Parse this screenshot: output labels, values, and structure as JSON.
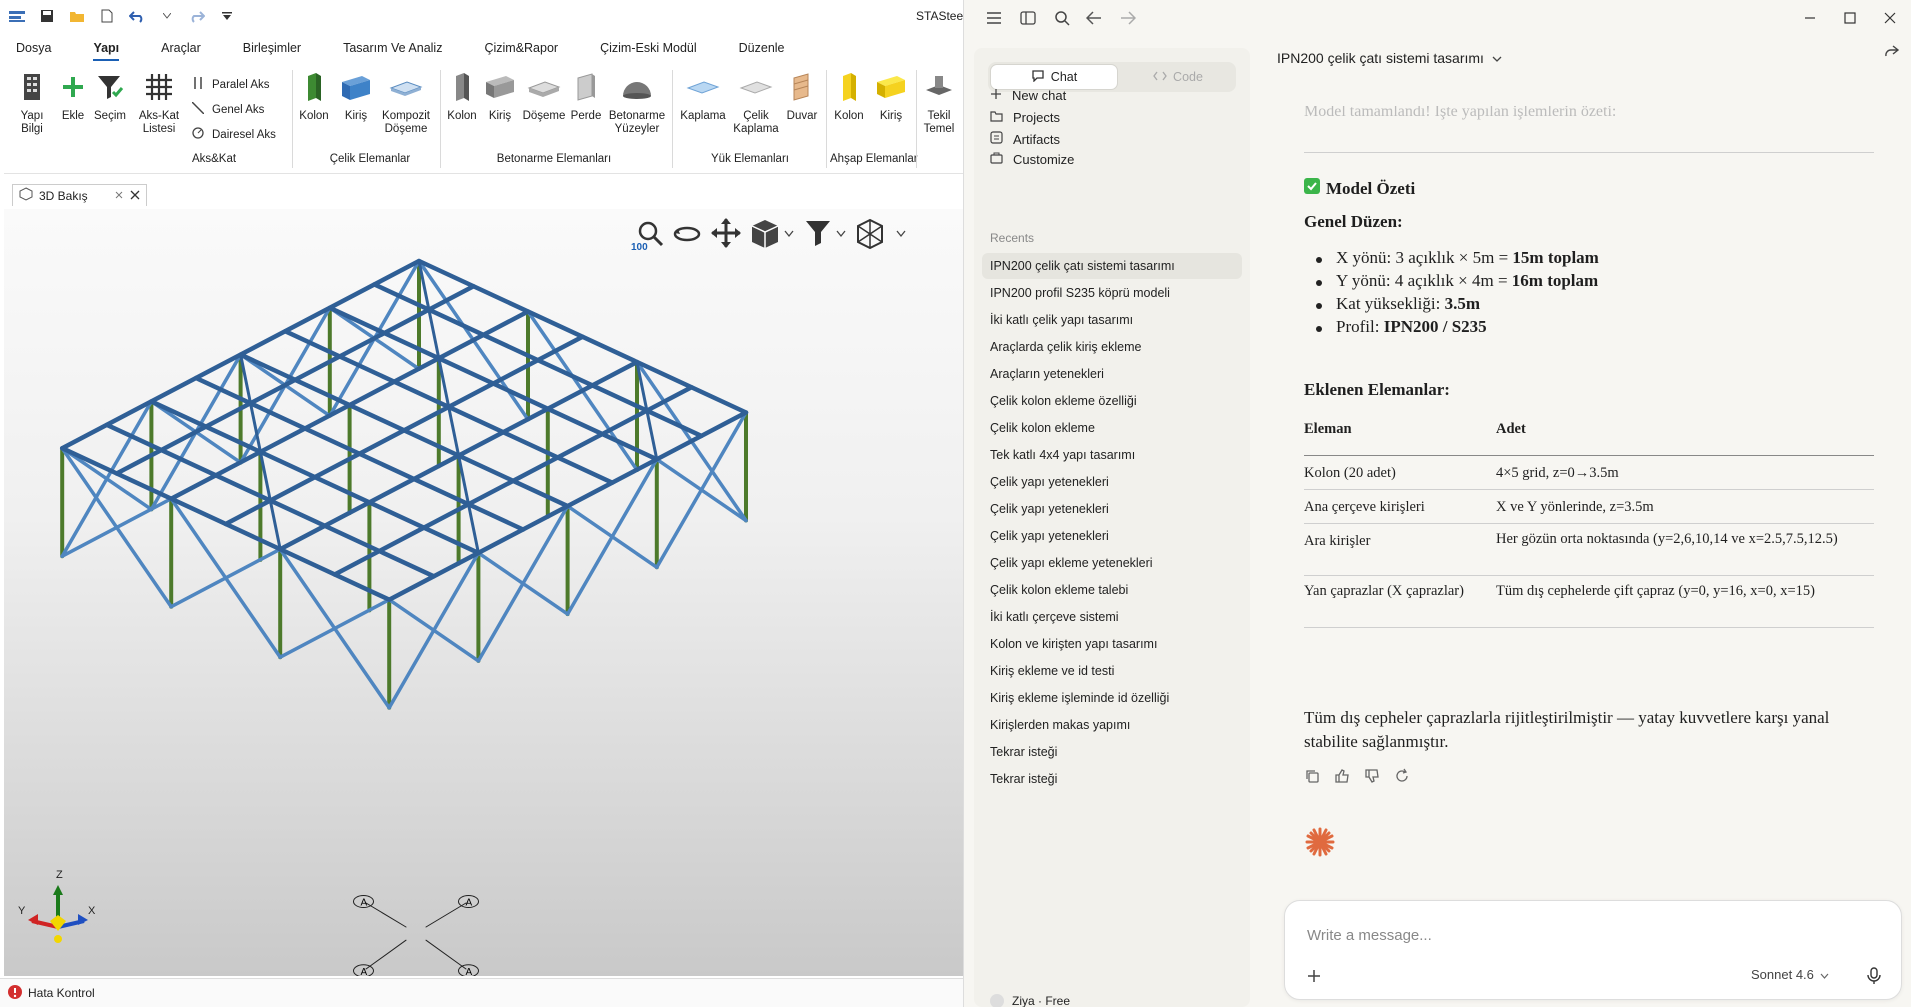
{
  "app": {
    "title": "STASteel",
    "menu": [
      "Dosya",
      "Yapı",
      "Araçlar",
      "Birleşimler",
      "Tasarım Ve Analiz",
      "Çizim&Rapor",
      "Çizim-Eski Modül",
      "Düzenle"
    ],
    "ribbon": {
      "yapi_bilgi": "Yapı Bilgi",
      "ekle": "Ekle",
      "secim": "Seçim",
      "aks_kat_1": "Aks-Kat",
      "aks_kat_2": "Listesi",
      "paralel_aks": "Paralel Aks",
      "genel_aks": "Genel Aks",
      "dairesel_aks": "Dairesel Aks",
      "group_akskat": "Aks&Kat",
      "celik_kolon": "Kolon",
      "celik_kiris": "Kiriş",
      "kompozit_1": "Kompozit",
      "kompozit_2": "Döşeme",
      "group_celik": "Çelik Elemanlar",
      "bet_kolon": "Kolon",
      "bet_kiris": "Kiriş",
      "bet_doseme": "Döşeme",
      "bet_perde": "Perde",
      "bet_yuzey_1": "Betonarme",
      "bet_yuzey_2": "Yüzeyler",
      "group_beton": "Betonarme Elemanları",
      "kaplama": "Kaplama",
      "celik_kaplama_1": "Çelik",
      "celik_kaplama_2": "Kaplama",
      "duvar": "Duvar",
      "group_yuk": "Yük Elemanları",
      "ahsap_kolon": "Kolon",
      "ahsap_kiris": "Kiriş",
      "group_ahsap": "Ahşap Elemanlar",
      "tekil_1": "Tekil",
      "tekil_2": "Temel"
    },
    "view_tab": "3D Bakış",
    "zoom": "100",
    "axes": {
      "x": "X",
      "y": "Y",
      "z": "Z"
    },
    "support_labels": [
      "A",
      "A",
      "A",
      "A"
    ],
    "status": "Hata Kontrol"
  },
  "claude": {
    "segment_chat": "Chat",
    "segment_code": "Code",
    "nav": [
      "New chat",
      "Projects",
      "Artifacts",
      "Customize"
    ],
    "recents_label": "Recents",
    "recents": [
      "IPN200 çelik çatı sistemi tasarımı",
      "IPN200 profil S235 köprü modeli",
      "İki katlı çelik yapı tasarımı",
      "Araçlarda çelik kiriş ekleme",
      "Araçların yetenekleri",
      "Çelik kolon ekleme özelliği",
      "Çelik kolon ekleme",
      "Tek katlı 4x4 yapı tasarımı",
      "Çelik yapı yetenekleri",
      "Çelik yapı yetenekleri",
      "Çelik yapı yetenekleri",
      "Çelik yapı ekleme yetenekleri",
      "Çelik kolon ekleme talebi",
      "İki katlı çerçeve sistemi",
      "Kolon ve kirişten yapı tasarımı",
      "Kiriş ekleme ve id testi",
      "Kiriş ekleme işleminde id özelliği",
      "Kirişlerden makas yapımı",
      "Tekrar isteği",
      "Tekrar isteği"
    ],
    "user": "Ziya · Free",
    "conversation_title": "IPN200 çelik çatı sistemi tasarımı",
    "faded_line": "Model tamamlandı! İşte yapılan işlemlerin özeti:",
    "heading_summary": "Model Özeti",
    "heading_layout": "Genel Düzen:",
    "bullets": [
      {
        "pre": "X yönü: 3 açıklık × 5m = ",
        "bold": "15m toplam"
      },
      {
        "pre": "Y yönü: 4 açıklık × 4m = ",
        "bold": "16m toplam"
      },
      {
        "pre": "Kat yüksekliği: ",
        "bold": "3.5m"
      },
      {
        "pre": "Profil: ",
        "bold": "IPN200 / S235"
      }
    ],
    "heading_elements": "Eklenen Elemanlar:",
    "table_headers": [
      "Eleman",
      "Adet"
    ],
    "table_rows": [
      [
        "Kolon (20 adet)",
        "4×5 grid, z=0→3.5m"
      ],
      [
        "Ana çerçeve kirişleri",
        "X ve Y yönlerinde, z=3.5m"
      ],
      [
        "Ara kirişler",
        "Her gözün orta noktasında (y=2,6,10,14 ve x=2.5,7.5,12.5)"
      ],
      [
        "Yan çaprazlar (X çaprazlar)",
        "Tüm dış cephelerde çift çapraz (y=0, y=16, x=0, x=15)"
      ]
    ],
    "summary": "Tüm dış cepheler çaprazlarla rijitleştirilmiştir — yatay kuvvetlere karşı yanal stabilite sağlanmıştır.",
    "input_placeholder": "Write a message...",
    "model": "Sonnet 4.6"
  }
}
